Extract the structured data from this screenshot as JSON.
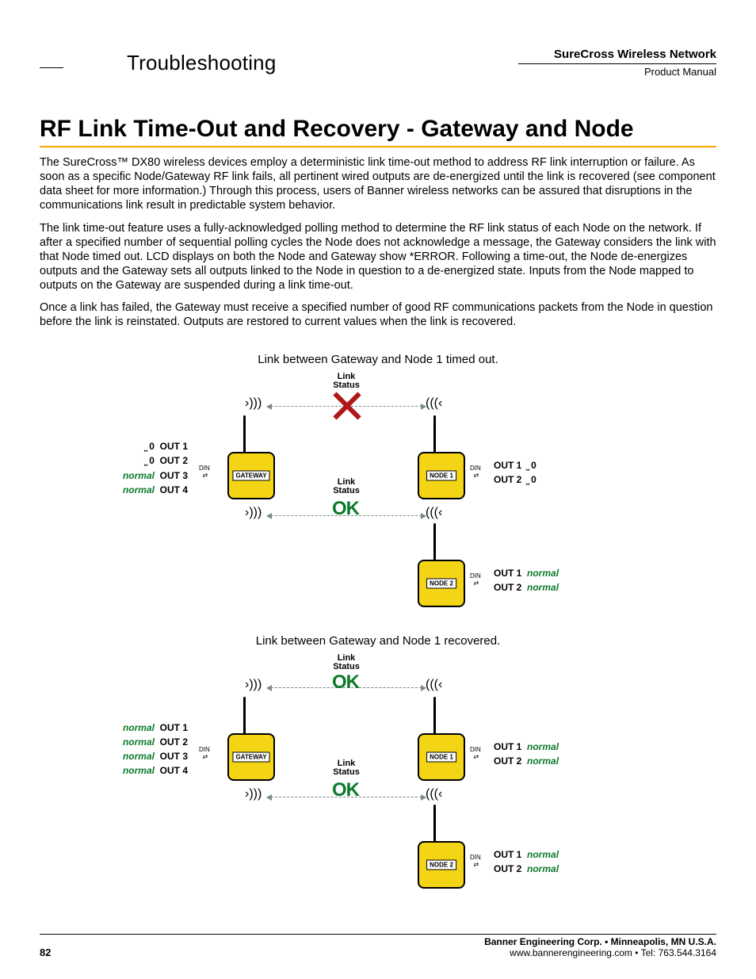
{
  "header": {
    "section": "Troubleshooting",
    "network": "SureCross Wireless Network",
    "subtitle": "Product Manual"
  },
  "title": "RF Link Time-Out and Recovery - Gateway and Node",
  "paragraphs": {
    "p1": "The SureCross™ DX80 wireless devices employ a deterministic link time-out method to address RF link interruption or failure. As soon as a specific Node/Gateway RF link fails, all pertinent wired outputs are de-energized until the link is recovered (see component data sheet for more information.) Through this process, users of Banner wireless networks can be assured that disruptions in the communications link result in predictable system behavior.",
    "p2": "The link time-out feature uses a fully-acknowledged polling method to determine the RF link status of each Node on the network. If after a specified number of sequential polling cycles the Node does not acknowledge a message, the Gateway considers the link with that Node timed out. LCD displays on both the Node and Gateway show *ERROR. Following a time-out, the Node de-energizes outputs and the Gateway sets all outputs linked to the Node in question to a de-energized state. Inputs from the Node mapped to outputs on the Gateway are suspended during a link time-out.",
    "p3": "Once a link has failed, the Gateway must receive a specified number of good RF communications packets from the Node in question before the link is reinstated. Outputs are restored to current values when the link is recovered."
  },
  "diagram1": {
    "caption": "Link between Gateway and Node 1 timed out.",
    "link_status_label": "Link\nStatus",
    "ok_label": "OK",
    "gateway_label": "GATEWAY",
    "node1_label": "NODE 1",
    "node2_label": "NODE 2",
    "din_label": "DIN",
    "gateway_outs": [
      {
        "label": "OUT 1",
        "state": "0",
        "type": "zero"
      },
      {
        "label": "OUT 2",
        "state": "0",
        "type": "zero"
      },
      {
        "label": "OUT 3",
        "state": "normal",
        "type": "normal"
      },
      {
        "label": "OUT 4",
        "state": "normal",
        "type": "normal"
      }
    ],
    "node1_outs": [
      {
        "label": "OUT 1",
        "state": "0",
        "type": "zero"
      },
      {
        "label": "OUT 2",
        "state": "0",
        "type": "zero"
      }
    ],
    "node2_outs": [
      {
        "label": "OUT 1",
        "state": "normal",
        "type": "normal"
      },
      {
        "label": "OUT 2",
        "state": "normal",
        "type": "normal"
      }
    ]
  },
  "diagram2": {
    "caption": "Link between Gateway and Node 1 recovered.",
    "link_status_label": "Link\nStatus",
    "ok_label": "OK",
    "gateway_label": "GATEWAY",
    "node1_label": "NODE 1",
    "node2_label": "NODE 2",
    "din_label": "DIN",
    "gateway_outs": [
      {
        "label": "OUT 1",
        "state": "normal",
        "type": "normal"
      },
      {
        "label": "OUT 2",
        "state": "normal",
        "type": "normal"
      },
      {
        "label": "OUT 3",
        "state": "normal",
        "type": "normal"
      },
      {
        "label": "OUT 4",
        "state": "normal",
        "type": "normal"
      }
    ],
    "node1_outs": [
      {
        "label": "OUT 1",
        "state": "normal",
        "type": "normal"
      },
      {
        "label": "OUT 2",
        "state": "normal",
        "type": "normal"
      }
    ],
    "node2_outs": [
      {
        "label": "OUT 1",
        "state": "normal",
        "type": "normal"
      },
      {
        "label": "OUT 2",
        "state": "normal",
        "type": "normal"
      }
    ]
  },
  "footer": {
    "line1": "Banner Engineering Corp. • Minneapolis, MN U.S.A.",
    "line2": "www.bannerengineering.com  •  Tel: 763.544.3164"
  },
  "page_number": "82"
}
